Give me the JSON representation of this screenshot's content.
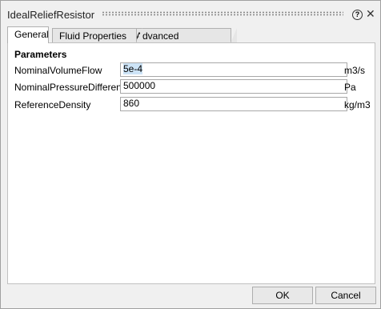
{
  "window": {
    "title": "IdealReliefResistor"
  },
  "tabs": [
    {
      "label": "General"
    },
    {
      "label": "Fluid Properties"
    },
    {
      "label": "Advanced Initialization"
    }
  ],
  "section": {
    "title": "Parameters"
  },
  "params": [
    {
      "label": "NominalVolumeFlow",
      "value": "5e-4",
      "unit": "m3/s"
    },
    {
      "label": "NominalPressureDifference",
      "value": "500000",
      "unit": "Pa"
    },
    {
      "label": "ReferenceDensity",
      "value": "860",
      "unit": "kg/m3"
    }
  ],
  "buttons": {
    "ok": "OK",
    "cancel": "Cancel"
  },
  "icons": {
    "help": "help-icon",
    "close": "close-icon"
  }
}
